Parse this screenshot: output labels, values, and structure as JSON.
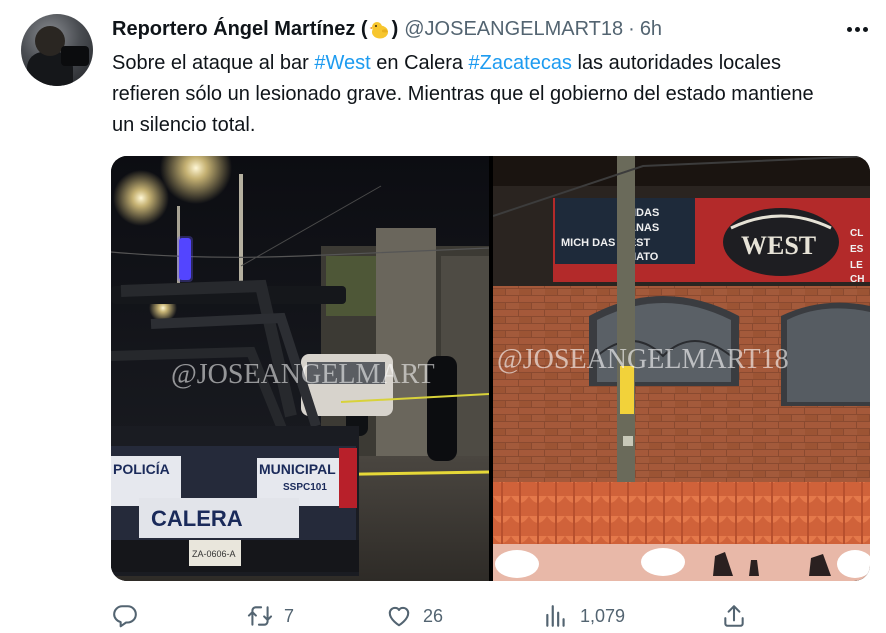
{
  "author": {
    "name": "Reportero Ángel Martínez (",
    "name_close": ")",
    "handle": "@JOSEANGELMART18",
    "separator": "·",
    "time": "6h"
  },
  "tweet": {
    "text_1": "Sobre el ataque al bar ",
    "hashtag_1": "#West",
    "text_2": " en Calera ",
    "hashtag_2": "#Zacatecas",
    "text_3": " las autoridades locales refieren sólo un lesionado grave. Mientras que el gobierno del estado mantiene un silencio total."
  },
  "media": {
    "left_watermark": "@JOSEANGELMART",
    "right_watermark": "@JOSEANGELMART18",
    "truck_label": "CALERA",
    "truck_municipal": "MUNICIPAL",
    "truck_code": "SSPC101",
    "truck_policia": "POLICÍA",
    "truck_plate": "ZA-0606-A",
    "sign_lines": [
      "IDAS",
      "ANAS",
      "MICH  DAS WEST",
      "MATO"
    ],
    "sign_brand": "WEST",
    "sign_side": [
      "CL",
      "ES",
      "LE",
      "CH"
    ]
  },
  "actions": {
    "reply_count": "",
    "retweet_count": "7",
    "like_count": "26",
    "views_count": "1,079"
  },
  "colors": {
    "hashtag": "#1d9bf0",
    "secondary_text": "#536471",
    "primary_text": "#0f1419"
  }
}
